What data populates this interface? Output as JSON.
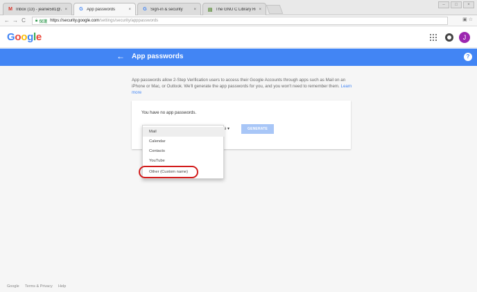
{
  "browser": {
    "tabs": [
      {
        "favicon": "gmail-icon",
        "title": "Inbox (13) - jeanie581@...",
        "active": false
      },
      {
        "favicon": "google-g-icon",
        "title": "App passwords",
        "active": true
      },
      {
        "favicon": "google-g-icon",
        "title": "Sign-in & security",
        "active": false
      },
      {
        "favicon": "library-icon",
        "title": "The GNU C Library Re...",
        "active": false
      }
    ],
    "tab_close": "×",
    "address": {
      "secure_label": "保護",
      "host": "https://security.google.com",
      "path": "/settings/security/apppasswords"
    }
  },
  "header": {
    "logo": "Google",
    "avatar_initial": "J"
  },
  "bluebar": {
    "title": "App passwords",
    "back_glyph": "←",
    "help_glyph": "?"
  },
  "description": {
    "text": "App passwords allow 2-Step Verification users to access their Google Accounts through apps such as Mail on an iPhone or Mac, or Outlook. We'll generate the app passwords for you, and you won't need to remember them.",
    "link": "Learn more"
  },
  "card": {
    "no_apps": "You have no app passwords.",
    "device_select": "ce",
    "generate": "GENERATE"
  },
  "dropdown": {
    "items": [
      "Mail",
      "Calendar",
      "Contacts",
      "YouTube",
      "Other (Custom name)"
    ],
    "selected": "Mail",
    "highlighted": "Other (Custom name)"
  },
  "footer": {
    "brand": "Google",
    "terms": "Terms & Privacy",
    "help": "Help"
  },
  "colors": {
    "accent": "#4285f4",
    "highlight_ring": "#d21b1b",
    "generate_disabled": "#a8c6f7",
    "avatar": "#9c27b0"
  }
}
